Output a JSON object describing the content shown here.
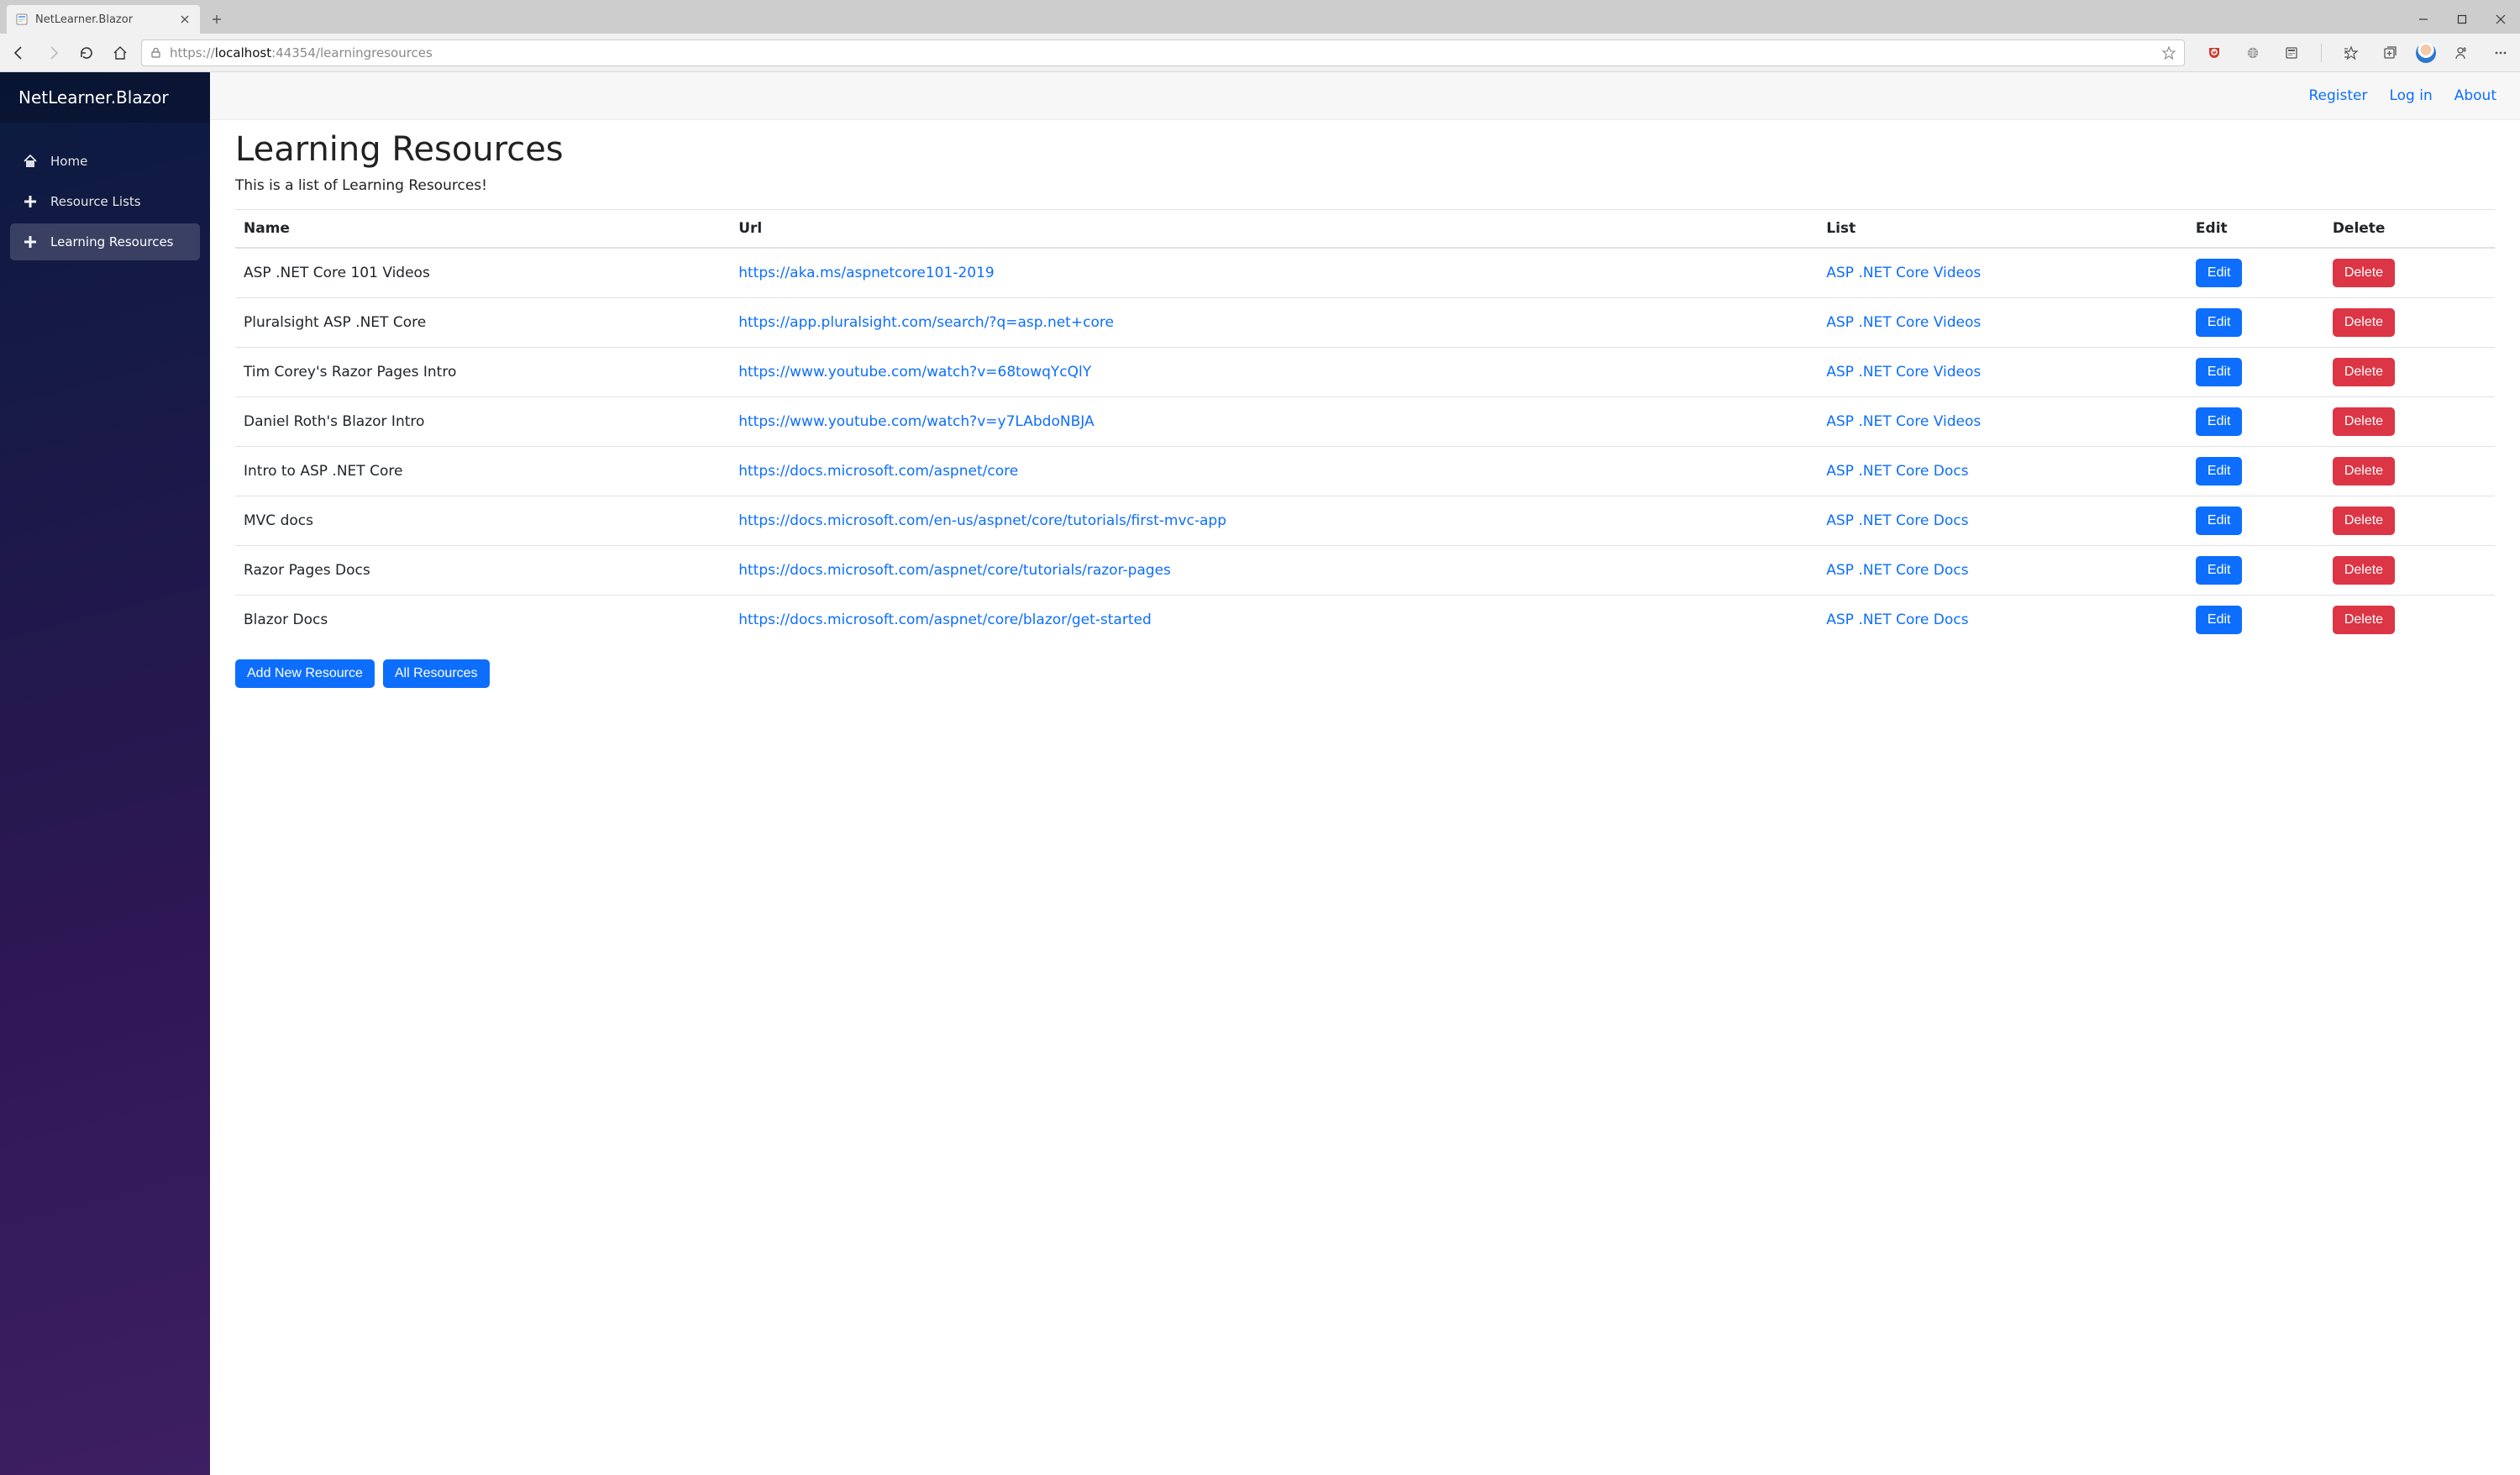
{
  "browser": {
    "tab_title": "NetLearner.Blazor",
    "url_prefix": "https://",
    "url_host": "localhost",
    "url_port_path": ":44354/learningresources"
  },
  "sidebar": {
    "brand": "NetLearner.Blazor",
    "items": [
      {
        "label": "Home"
      },
      {
        "label": "Resource Lists"
      },
      {
        "label": "Learning Resources"
      }
    ]
  },
  "topbar": {
    "register": "Register",
    "login": "Log in",
    "about": "About"
  },
  "page": {
    "title": "Learning Resources",
    "subtitle": "This is a list of Learning Resources!"
  },
  "table": {
    "headers": {
      "name": "Name",
      "url": "Url",
      "list": "List",
      "edit": "Edit",
      "delete": "Delete"
    },
    "edit_label": "Edit",
    "delete_label": "Delete",
    "rows": [
      {
        "name": "ASP .NET Core 101 Videos",
        "url": "https://aka.ms/aspnetcore101-2019",
        "list": "ASP .NET Core Videos"
      },
      {
        "name": "Pluralsight ASP .NET Core",
        "url": "https://app.pluralsight.com/search/?q=asp.net+core",
        "list": "ASP .NET Core Videos"
      },
      {
        "name": "Tim Corey's Razor Pages Intro",
        "url": "https://www.youtube.com/watch?v=68towqYcQlY",
        "list": "ASP .NET Core Videos"
      },
      {
        "name": "Daniel Roth's Blazor Intro",
        "url": "https://www.youtube.com/watch?v=y7LAbdoNBJA",
        "list": "ASP .NET Core Videos"
      },
      {
        "name": "Intro to ASP .NET Core",
        "url": "https://docs.microsoft.com/aspnet/core",
        "list": "ASP .NET Core Docs"
      },
      {
        "name": "MVC docs",
        "url": "https://docs.microsoft.com/en-us/aspnet/core/tutorials/first-mvc-app",
        "list": "ASP .NET Core Docs"
      },
      {
        "name": "Razor Pages Docs",
        "url": "https://docs.microsoft.com/aspnet/core/tutorials/razor-pages",
        "list": "ASP .NET Core Docs"
      },
      {
        "name": "Blazor Docs",
        "url": "https://docs.microsoft.com/aspnet/core/blazor/get-started",
        "list": "ASP .NET Core Docs"
      }
    ]
  },
  "actions": {
    "add_new": "Add New Resource",
    "all": "All Resources"
  }
}
